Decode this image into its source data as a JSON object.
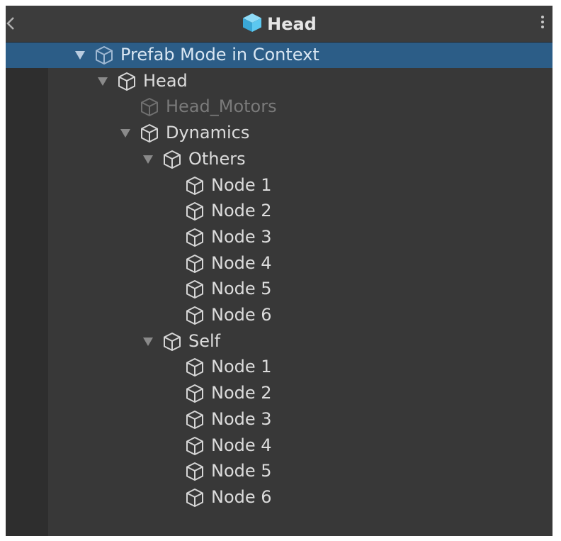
{
  "window": {
    "title": "Head"
  },
  "colors": {
    "panel_bg": "#383838",
    "header_bg": "#3c3c3c",
    "selection": "#2c5d87",
    "text": "#dcdcdc",
    "dimmed_text": "#7a7a7a",
    "prefab_icon": "#5cc8f0"
  },
  "icons": {
    "header": "prefab-cube-icon",
    "node": "cube-outline-icon",
    "back": "chevron-left-icon",
    "menu": "kebab-menu-icon"
  },
  "tree": [
    {
      "label": "Prefab Mode in Context",
      "depth": 0,
      "expanded": true,
      "selected": true,
      "dimmed": false
    },
    {
      "label": "Head",
      "depth": 1,
      "expanded": true,
      "selected": false,
      "dimmed": false
    },
    {
      "label": "Head_Motors",
      "depth": 2,
      "expanded": null,
      "selected": false,
      "dimmed": true
    },
    {
      "label": "Dynamics",
      "depth": 2,
      "expanded": true,
      "selected": false,
      "dimmed": false
    },
    {
      "label": "Others",
      "depth": 3,
      "expanded": true,
      "selected": false,
      "dimmed": false
    },
    {
      "label": "Node 1",
      "depth": 4,
      "expanded": null,
      "selected": false,
      "dimmed": false
    },
    {
      "label": "Node 2",
      "depth": 4,
      "expanded": null,
      "selected": false,
      "dimmed": false
    },
    {
      "label": "Node 3",
      "depth": 4,
      "expanded": null,
      "selected": false,
      "dimmed": false
    },
    {
      "label": "Node 4",
      "depth": 4,
      "expanded": null,
      "selected": false,
      "dimmed": false
    },
    {
      "label": "Node 5",
      "depth": 4,
      "expanded": null,
      "selected": false,
      "dimmed": false
    },
    {
      "label": "Node 6",
      "depth": 4,
      "expanded": null,
      "selected": false,
      "dimmed": false
    },
    {
      "label": "Self",
      "depth": 3,
      "expanded": true,
      "selected": false,
      "dimmed": false
    },
    {
      "label": "Node 1",
      "depth": 4,
      "expanded": null,
      "selected": false,
      "dimmed": false
    },
    {
      "label": "Node 2",
      "depth": 4,
      "expanded": null,
      "selected": false,
      "dimmed": false
    },
    {
      "label": "Node 3",
      "depth": 4,
      "expanded": null,
      "selected": false,
      "dimmed": false
    },
    {
      "label": "Node 4",
      "depth": 4,
      "expanded": null,
      "selected": false,
      "dimmed": false
    },
    {
      "label": "Node 5",
      "depth": 4,
      "expanded": null,
      "selected": false,
      "dimmed": false
    },
    {
      "label": "Node 6",
      "depth": 4,
      "expanded": null,
      "selected": false,
      "dimmed": false
    }
  ]
}
